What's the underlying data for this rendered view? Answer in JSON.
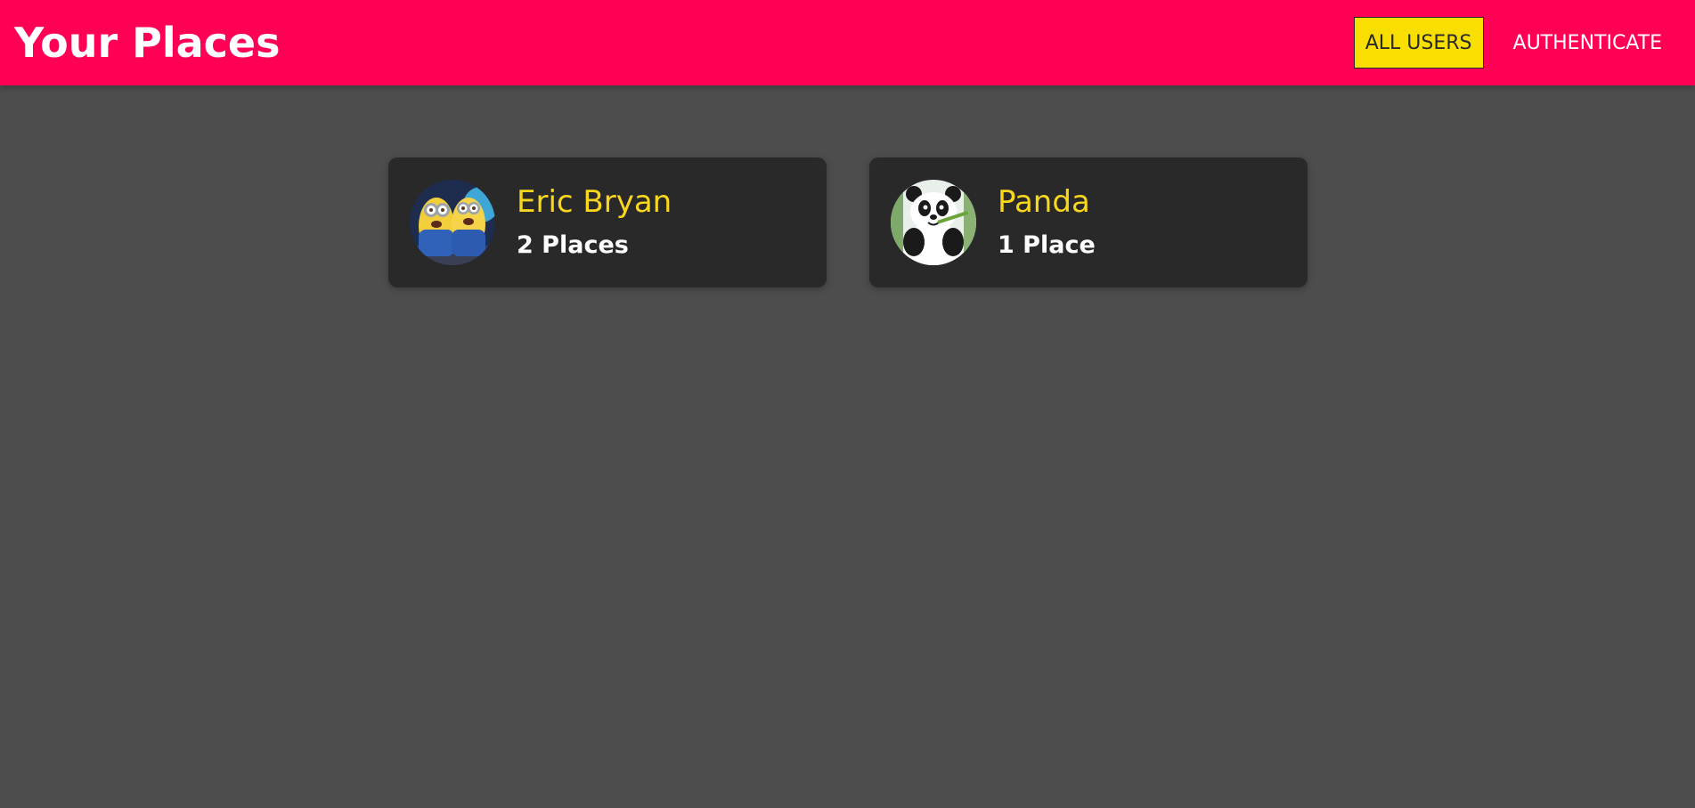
{
  "header": {
    "title": "Your Places",
    "nav": [
      {
        "label": "ALL USERS",
        "active": true
      },
      {
        "label": "AUTHENTICATE",
        "active": false
      }
    ]
  },
  "users": [
    {
      "name": "Eric Bryan",
      "places_label": "2 Places",
      "avatar_icon": "minions-avatar-icon"
    },
    {
      "name": "Panda",
      "places_label": "1 Place",
      "avatar_icon": "panda-avatar-icon"
    }
  ],
  "colors": {
    "header_bg": "#ff0055",
    "page_bg": "#4d4d4d",
    "card_bg": "#292929",
    "accent_yellow": "#f8d71c",
    "active_nav_bg": "#f8df00"
  }
}
